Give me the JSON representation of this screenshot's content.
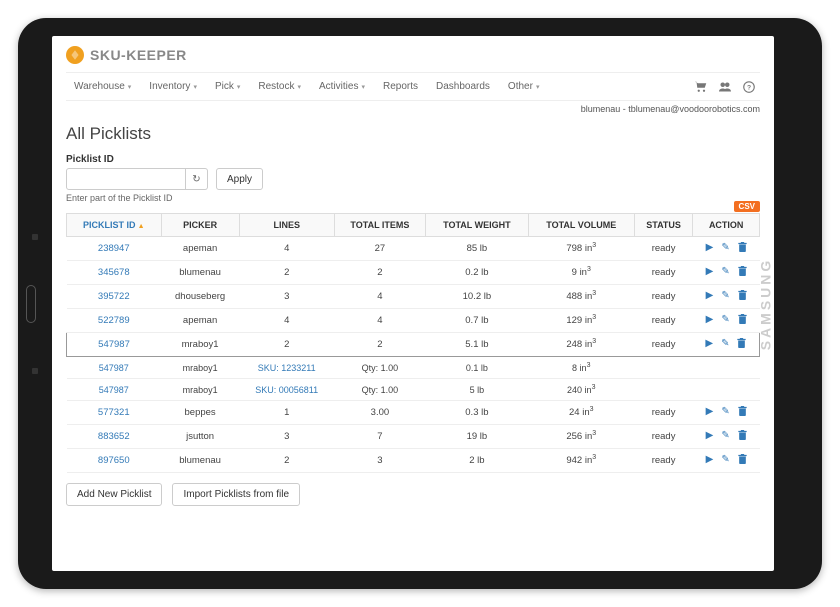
{
  "brand": {
    "name": "SKU-KEEPER"
  },
  "nav": {
    "items": [
      "Warehouse",
      "Inventory",
      "Pick",
      "Restock",
      "Activities",
      "Reports",
      "Dashboards",
      "Other"
    ]
  },
  "user": {
    "display": "blumenau - tblumenau@voodoorobotics.com"
  },
  "page": {
    "title": "All Picklists"
  },
  "filter": {
    "label": "Picklist ID",
    "apply": "Apply",
    "help": "Enter part of the Picklist ID"
  },
  "table": {
    "csv": "CSV",
    "cols": [
      "PICKLIST ID",
      "PICKER",
      "LINES",
      "TOTAL ITEMS",
      "TOTAL WEIGHT",
      "TOTAL VOLUME",
      "STATUS",
      "ACTION"
    ],
    "rows": [
      {
        "id": "238947",
        "picker": "apeman",
        "lines": "4",
        "items": "27",
        "weight": "85 lb",
        "volume": "798 in",
        "status": "ready",
        "actions": true
      },
      {
        "id": "345678",
        "picker": "blumenau",
        "lines": "2",
        "items": "2",
        "weight": "0.2 lb",
        "volume": "9 in",
        "status": "ready",
        "actions": true
      },
      {
        "id": "395722",
        "picker": "dhouseberg",
        "lines": "3",
        "items": "4",
        "weight": "10.2 lb",
        "volume": "488 in",
        "status": "ready",
        "actions": true
      },
      {
        "id": "522789",
        "picker": "apeman",
        "lines": "4",
        "items": "4",
        "weight": "0.7 lb",
        "volume": "129 in",
        "status": "ready",
        "actions": true
      },
      {
        "id": "547987",
        "picker": "mraboy1",
        "lines": "2",
        "items": "2",
        "weight": "5.1 lb",
        "volume": "248 in",
        "status": "ready",
        "actions": true,
        "selected": true
      },
      {
        "id": "547987",
        "picker": "mraboy1",
        "sku": "SKU: 1233211",
        "qty": "Qty: 1.00",
        "weight": "0.1 lb",
        "volume": "8 in",
        "sub": true
      },
      {
        "id": "547987",
        "picker": "mraboy1",
        "sku": "SKU: 00056811",
        "qty": "Qty: 1.00",
        "weight": "5 lb",
        "volume": "240 in",
        "sub": true
      },
      {
        "id": "577321",
        "picker": "beppes",
        "lines": "1",
        "items": "3.00",
        "weight": "0.3 lb",
        "volume": "24 in",
        "status": "ready",
        "actions": true
      },
      {
        "id": "883652",
        "picker": "jsutton",
        "lines": "3",
        "items": "7",
        "weight": "19 lb",
        "volume": "256 in",
        "status": "ready",
        "actions": true
      },
      {
        "id": "897650",
        "picker": "blumenau",
        "lines": "2",
        "items": "3",
        "weight": "2 lb",
        "volume": "942 in",
        "status": "ready",
        "actions": true
      }
    ]
  },
  "buttons": {
    "add": "Add New Picklist",
    "import": "Import Picklists from file"
  },
  "colors": {
    "link": "#337ab7",
    "accent": "#f36f21",
    "brand": "#f0a020"
  }
}
